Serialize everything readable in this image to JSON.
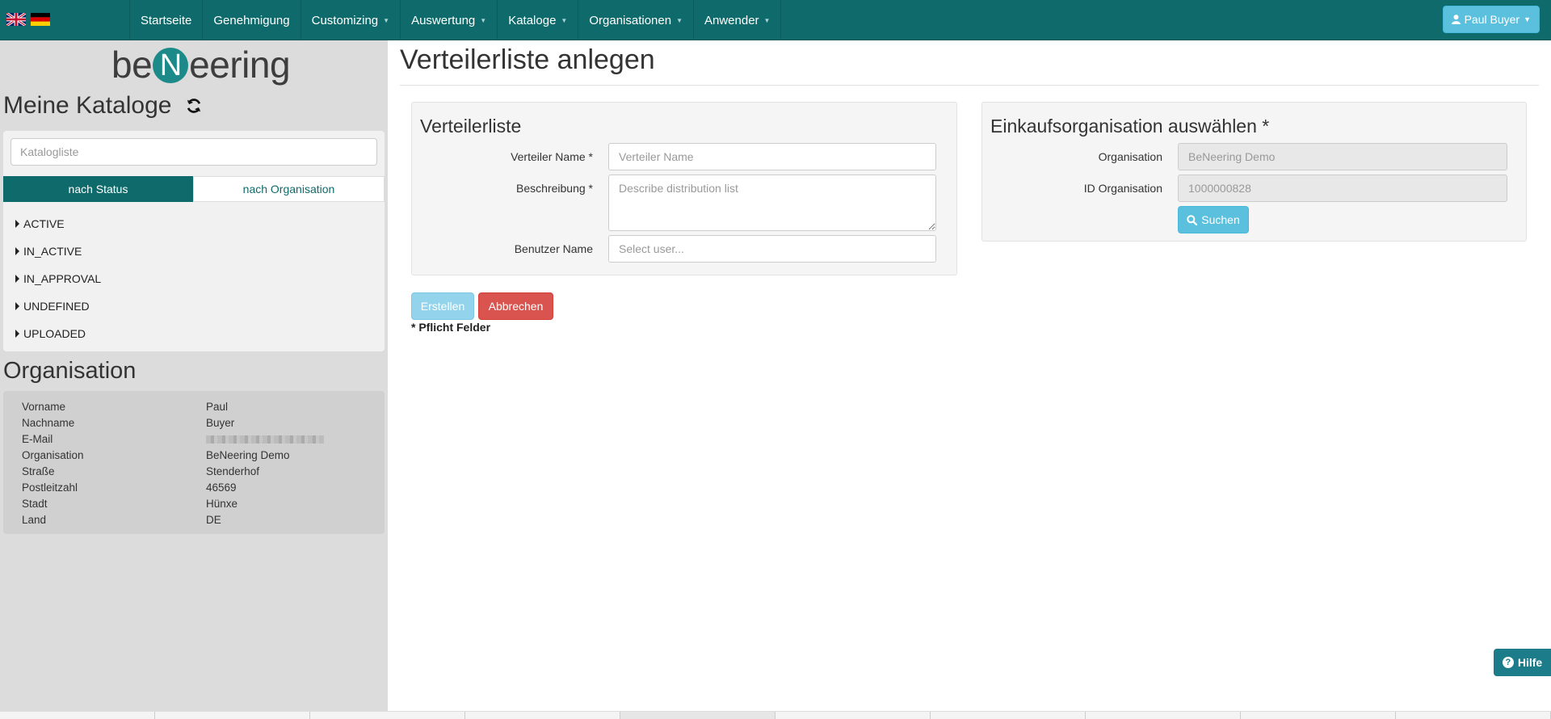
{
  "nav": {
    "items": [
      {
        "label": "Startseite",
        "dropdown": false
      },
      {
        "label": "Genehmigung",
        "dropdown": false
      },
      {
        "label": "Customizing",
        "dropdown": true
      },
      {
        "label": "Auswertung",
        "dropdown": true
      },
      {
        "label": "Kataloge",
        "dropdown": true
      },
      {
        "label": "Organisationen",
        "dropdown": true
      },
      {
        "label": "Anwender",
        "dropdown": true
      }
    ],
    "user_label": "Paul Buyer",
    "flags": [
      "flag-uk-icon",
      "flag-de-icon"
    ]
  },
  "sidebar": {
    "logo": {
      "pre": "be",
      "mark": "N",
      "post": "eering"
    },
    "catalogs_heading": "Meine Kataloge",
    "catalog_search_placeholder": "Katalogliste",
    "tabs": {
      "by_status": "nach Status",
      "by_org": "nach Organisation"
    },
    "status_items": [
      "ACTIVE",
      "IN_ACTIVE",
      "IN_APPROVAL",
      "UNDEFINED",
      "UPLOADED"
    ],
    "org_heading": "Organisation",
    "org_rows": [
      {
        "label": "Vorname",
        "value": "Paul"
      },
      {
        "label": "Nachname",
        "value": "Buyer"
      },
      {
        "label": "E-Mail",
        "value": ""
      },
      {
        "label": "Organisation",
        "value": "BeNeering Demo"
      },
      {
        "label": "Straße",
        "value": "Stenderhof"
      },
      {
        "label": "Postleitzahl",
        "value": "46569"
      },
      {
        "label": "Stadt",
        "value": "Hünxe"
      },
      {
        "label": "Land",
        "value": "DE"
      }
    ]
  },
  "main": {
    "page_title": "Verteilerliste anlegen",
    "distribution": {
      "heading": "Verteilerliste",
      "name_label": "Verteiler Name *",
      "name_placeholder": "Verteiler Name",
      "desc_label": "Beschreibung *",
      "desc_placeholder": "Describe distribution list",
      "user_label": "Benutzer Name",
      "user_placeholder": "Select user..."
    },
    "purchasing": {
      "heading": "Einkaufsorganisation auswählen *",
      "org_label": "Organisation",
      "org_value": "BeNeering Demo",
      "id_label": "ID Organisation",
      "id_value": "1000000828",
      "search_button": "Suchen"
    },
    "create_button": "Erstellen",
    "cancel_button": "Abbrechen",
    "required_note": "* Pflicht Felder",
    "help_button": "Hilfe"
  },
  "colors": {
    "navbar": "#0f6b6b",
    "info_button": "#5bc0de",
    "danger_button": "#d9534f",
    "sidebar_bg": "#dcdcdc"
  }
}
